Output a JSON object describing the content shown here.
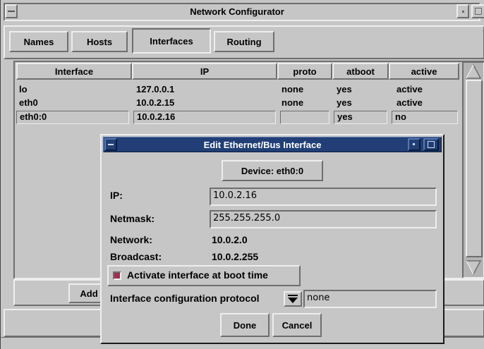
{
  "window": {
    "title": "Network Configurator"
  },
  "tabs": [
    {
      "label": "Names"
    },
    {
      "label": "Hosts"
    },
    {
      "label": "Interfaces",
      "selected": true
    },
    {
      "label": "Routing"
    }
  ],
  "table": {
    "columns": [
      "Interface",
      "IP",
      "proto",
      "atboot",
      "active"
    ],
    "rows": [
      {
        "interface": "lo",
        "ip": "127.0.0.1",
        "proto": "none",
        "atboot": "yes",
        "active": "active"
      },
      {
        "interface": "eth0",
        "ip": "10.0.2.15",
        "proto": "none",
        "atboot": "yes",
        "active": "active"
      },
      {
        "interface": "eth0:0",
        "ip": "10.0.2.16",
        "proto": "",
        "atboot": "yes",
        "active": "no"
      }
    ]
  },
  "main_buttons": {
    "add_label": "Add"
  },
  "dialog": {
    "title": "Edit Ethernet/Bus Interface",
    "device_button": "Device: eth0:0",
    "ip_label": "IP:",
    "ip_value": "10.0.2.16",
    "netmask_label": "Netmask:",
    "netmask_value": "255.255.255.0",
    "network_label": "Network:",
    "network_value": "10.0.2.0",
    "broadcast_label": "Broadcast:",
    "broadcast_value": "10.0.2.255",
    "activate_label": "Activate interface at boot time",
    "activate_checked": true,
    "protocol_label": "Interface configuration protocol",
    "protocol_value": "none",
    "done_label": "Done",
    "cancel_label": "Cancel"
  },
  "colors": {
    "dialog_title_bg": "#213f76",
    "checkbox_on": "#a03050",
    "window_bg": "#c6c6c6"
  }
}
